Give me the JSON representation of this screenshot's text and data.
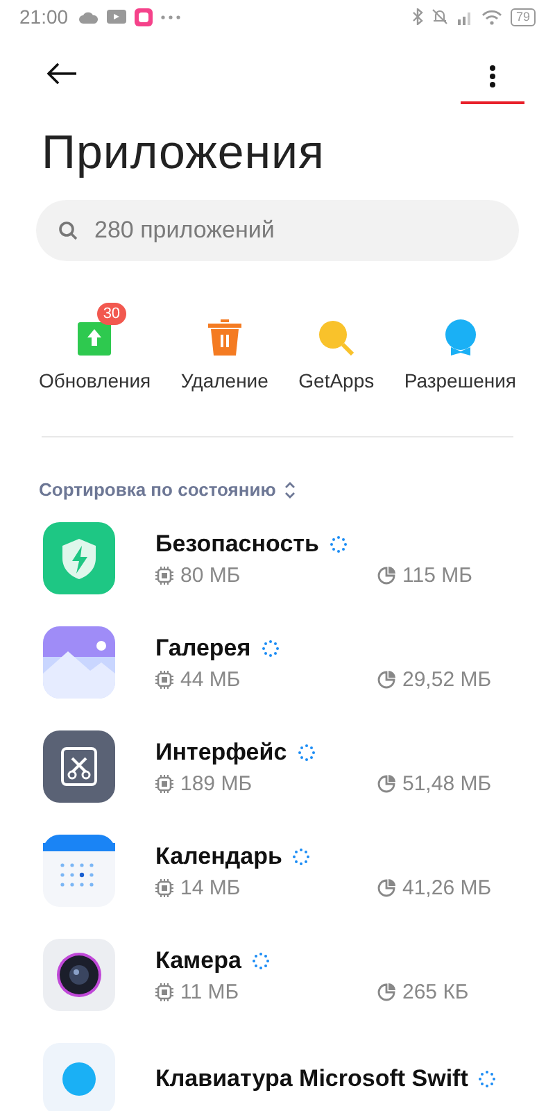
{
  "status_bar": {
    "time": "21:00",
    "battery": "79"
  },
  "title": "Приложения",
  "search": {
    "placeholder": "280 приложений"
  },
  "actions": [
    {
      "kind": "update",
      "label": "Обновления",
      "badge": "30"
    },
    {
      "kind": "delete",
      "label": "Удаление"
    },
    {
      "kind": "getapps",
      "label": "GetApps"
    },
    {
      "kind": "permissions",
      "label": "Разрешения"
    }
  ],
  "sort": {
    "label": "Сортировка по состоянию"
  },
  "apps": [
    {
      "kind": "security",
      "name": "Безопасность",
      "ram": "80 МБ",
      "storage": "115 МБ"
    },
    {
      "kind": "gallery",
      "name": "Галерея",
      "ram": "44 МБ",
      "storage": "29,52 МБ"
    },
    {
      "kind": "interface",
      "name": "Интерфейс",
      "ram": "189 МБ",
      "storage": "51,48 МБ"
    },
    {
      "kind": "calendar",
      "name": "Календарь",
      "ram": "14 МБ",
      "storage": "41,26 МБ"
    },
    {
      "kind": "camera",
      "name": "Камера",
      "ram": "11 МБ",
      "storage": "265 КБ"
    },
    {
      "kind": "keyboard",
      "name": "Клавиатура Microsoft Swift"
    }
  ]
}
